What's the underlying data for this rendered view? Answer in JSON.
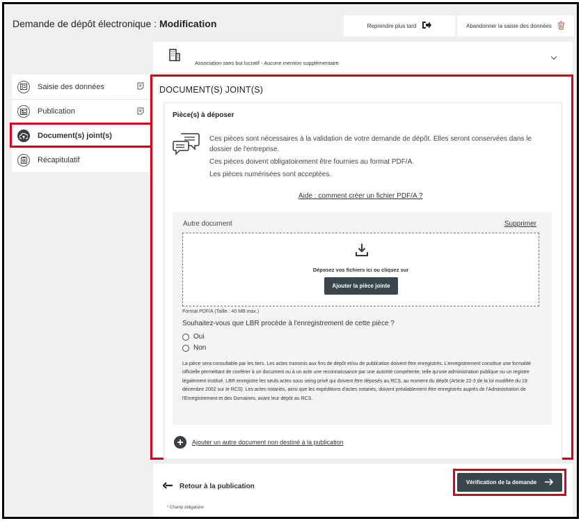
{
  "header": {
    "title_prefix": "Demande de dépôt électronique : ",
    "title_bold": "Modification",
    "resume_label": "Reprendre plus tard",
    "abandon_label": "Abandonner la saisie des données"
  },
  "association": {
    "text": "Association sans but lucratif - Aucune mention supplémentaire"
  },
  "sidebar": {
    "items": [
      {
        "label": "Saisie des données",
        "icon": "form-icon"
      },
      {
        "label": "Publication",
        "icon": "newspaper-icon"
      },
      {
        "label": "Document(s) joint(s)",
        "icon": "cloud-upload-icon",
        "active": true
      },
      {
        "label": "Récapitulatif",
        "icon": "clipboard-icon"
      }
    ]
  },
  "main": {
    "title": "DOCUMENT(S) JOINT(S)",
    "card_title": "Pièce(s) à déposer",
    "info": [
      "Ces pièces sont nécessaires à la validation de votre demande de dépôt. Elles seront conservées dans le dossier de l'entreprise.",
      "Ces pièces doivent obligatoirement être fournies au format PDF/A.",
      "Les pièces numérisées sont acceptées."
    ],
    "help_link": "Aide : comment créer un fichier PDF/A ?",
    "doc": {
      "label": "Autre document",
      "delete": "Supprimer",
      "drop_text": "Déposez vos fichiers ici ou cliquez sur",
      "attach_button": "Ajouter la pièce jointe",
      "format_note": "Format PDF/A (Taille : 40 MB max.)",
      "question": "Souhaitez-vous que LBR procède à l'enregistrement de cette pièce ?",
      "option_yes": "Oui",
      "option_no": "Non",
      "legal": "La pièce sera consultable par les tiers. Les actes transmis aux fins de dépôt et/ou de publication doivent être enregistrés. L'enregistrement constitue une formalité officielle permettant de conférer à un document ou à un acte une reconnaissance par une autorité compétente, telle qu'une administration publique ou un registre légalement institué. LBR enregistre les seuls actes sous seing privé qui doivent être déposés au RCS, au moment du dépôt (Article 22-3 de la loi modifiée du 19 décembre 2002 sur le RCS). Les actes notariés, ainsi que les expéditions d'actes notariés, doivent préalablement être enregistrés auprès de l'Administration de l'Enregistrement et des Domaines, avant leur dépôt au RCS."
    },
    "add_other": "Ajouter un autre document non destiné à la publication"
  },
  "footer": {
    "back_label": "Retour à la publication",
    "verify_label": "Vérification de la demande",
    "mandatory_star": "*",
    "mandatory_label": "Champ obligatoire"
  },
  "colors": {
    "highlight": "#d5001c",
    "dark_button": "#3a464e"
  }
}
